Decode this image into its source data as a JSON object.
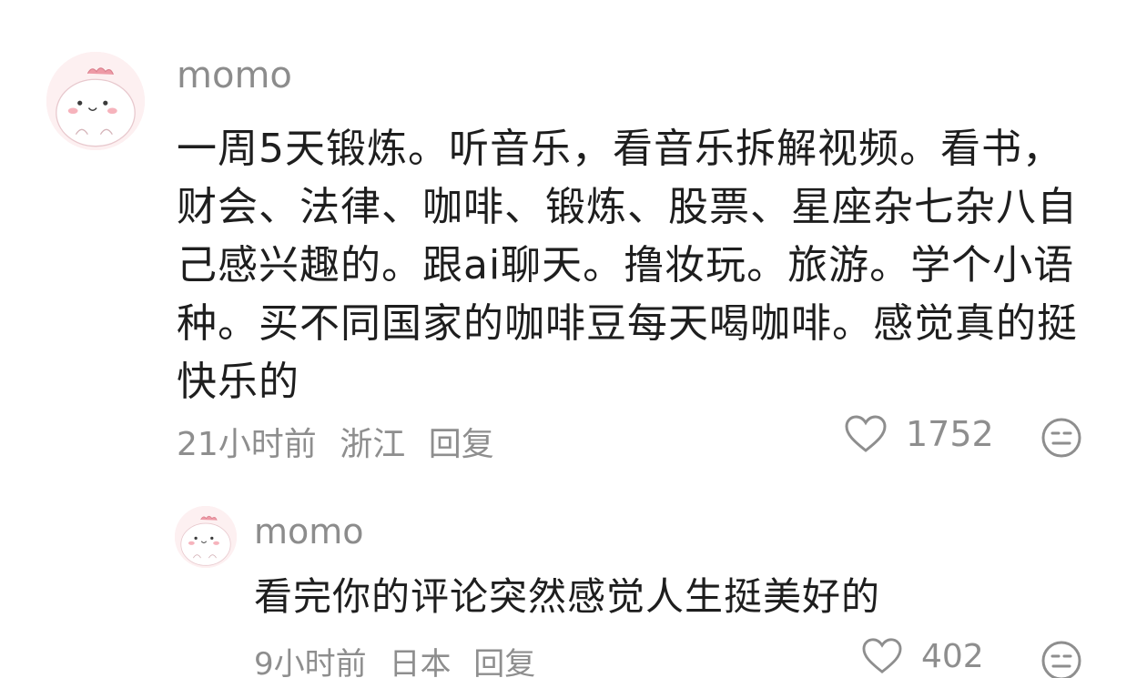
{
  "comment": {
    "username": "momo",
    "text": "一周5天锻炼。听音乐，看音乐拆解视频。看书，财会、法律、咖啡、锻炼、股票、星座杂七杂八自己感兴趣的。跟ai聊天。撸妆玩。旅游。学个小语种。买不同国家的咖啡豆每天喝咖啡。感觉真的挺快乐的",
    "time": "21小时前",
    "location": "浙江",
    "reply_label": "回复",
    "likes": "1752",
    "like_icon": "heart-icon",
    "dislike_icon": "meh-face-icon"
  },
  "reply": {
    "username": "momo",
    "text": "看完你的评论突然感觉人生挺美好的",
    "time": "9小时前",
    "location": "日本",
    "reply_label": "回复",
    "likes": "402",
    "like_icon": "heart-icon",
    "dislike_icon": "meh-face-icon"
  },
  "colors": {
    "username": "#8c8c8c",
    "text": "#1e1e1e",
    "meta": "#8e8e8e",
    "avatar_bg": "#fbe7ea"
  }
}
